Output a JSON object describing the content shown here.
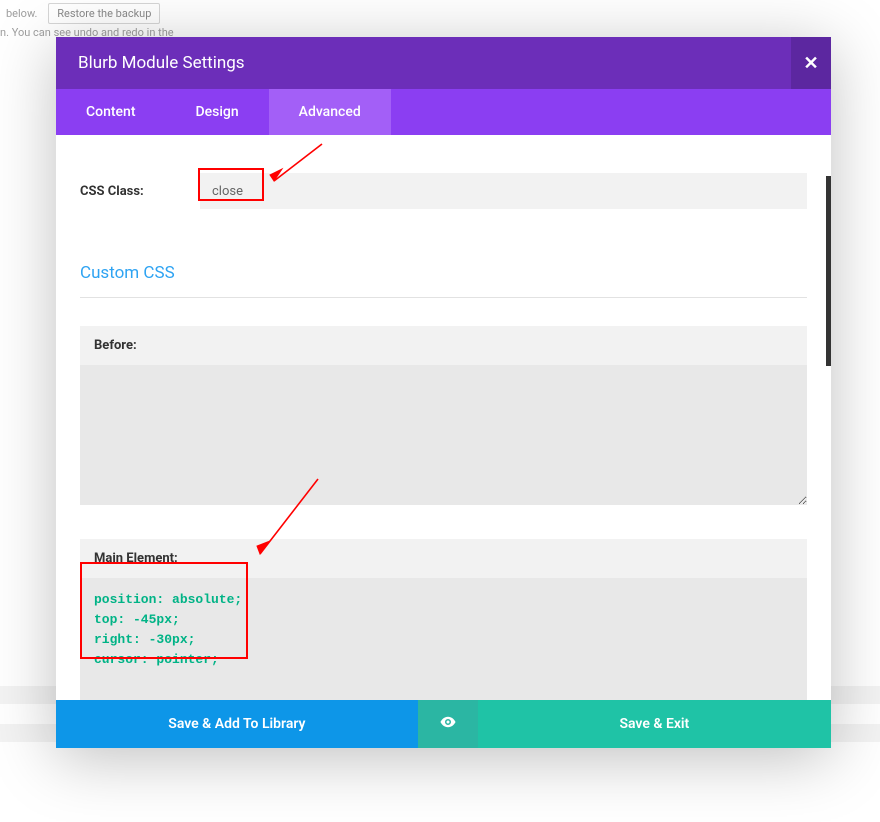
{
  "background": {
    "below_text": "below.",
    "restore_btn": "Restore the backup",
    "line2": "n. You can see undo and redo in the"
  },
  "modal": {
    "title": "Blurb Module Settings"
  },
  "tabs": {
    "content": "Content",
    "design": "Design",
    "advanced": "Advanced"
  },
  "fields": {
    "css_class": {
      "label": "CSS Class:",
      "value": "close"
    }
  },
  "section": {
    "custom_css": "Custom CSS"
  },
  "css_boxes": {
    "before": {
      "label": "Before:",
      "value": ""
    },
    "main": {
      "label": "Main Element:",
      "value": "position: absolute;\ntop: -45px;\nright: -30px;\ncursor: pointer;"
    }
  },
  "footer": {
    "save_lib": "Save & Add To Library",
    "save_exit": "Save & Exit"
  }
}
